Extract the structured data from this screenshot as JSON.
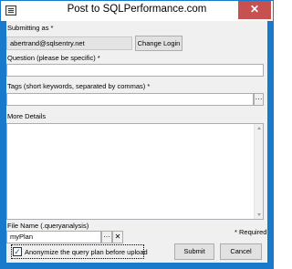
{
  "window": {
    "title": "Post to SQLPerformance.com",
    "close_label": "✕"
  },
  "submitting": {
    "label": "Submitting as *",
    "email": "abertrand@sqlsentry.net",
    "change_login_label": "Change Login"
  },
  "question": {
    "label": "Question (please be specific) *",
    "value": ""
  },
  "tags": {
    "label": "Tags (short keywords, separated by commas) *",
    "value": "",
    "browse_label": "···"
  },
  "details": {
    "label": "More Details",
    "value": ""
  },
  "file": {
    "label": "File Name (.queryanalysis)",
    "value": "myPlan",
    "browse_label": "···",
    "clear_label": "✕"
  },
  "required_note": "* Required",
  "anonymize": {
    "label": "Anonymize the query plan before upload",
    "checked": true,
    "check_glyph": "✓"
  },
  "buttons": {
    "submit": "Submit",
    "cancel": "Cancel"
  },
  "colors": {
    "accent_border": "#1979ca",
    "close_bg": "#c75050",
    "client_bg": "#f0f0f0"
  }
}
